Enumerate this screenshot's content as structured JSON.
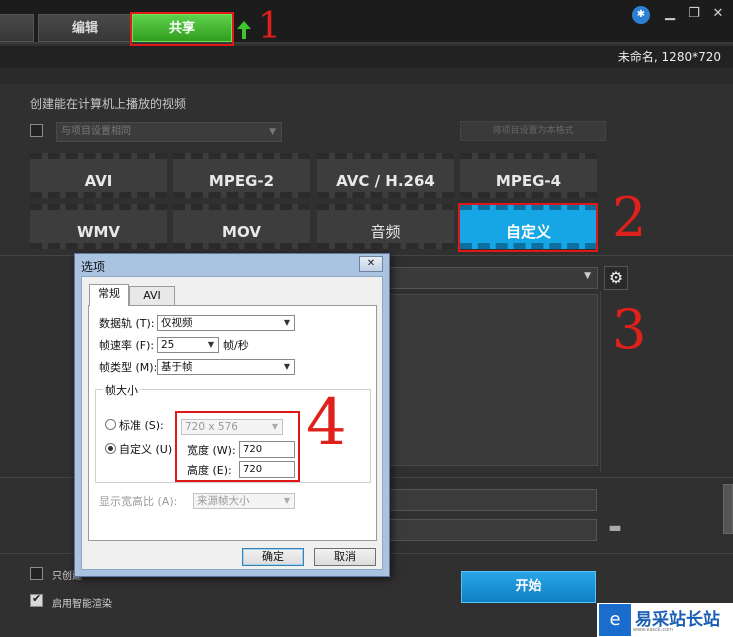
{
  "topbar": {
    "tabs": [
      {
        "label": ""
      },
      {
        "label": "编辑"
      },
      {
        "label": "共享"
      }
    ],
    "controls": {
      "help_icon": "compass-icon",
      "minimize": "▁",
      "restore": "❐",
      "close": "✕"
    }
  },
  "infobar": {
    "project": "未命名, 1280*720"
  },
  "share": {
    "title": "创建能在计算机上播放的视频",
    "same_as_project_checkbox": "与项目设置相同",
    "disabled_button": "将项目设置为本格式"
  },
  "formats": {
    "row1": [
      {
        "label": "AVI"
      },
      {
        "label": "MPEG-2"
      },
      {
        "label": "AVC / H.264"
      },
      {
        "label": "MPEG-4"
      }
    ],
    "row2": [
      {
        "label": "WMV"
      },
      {
        "label": "MOV"
      },
      {
        "label": "音频"
      },
      {
        "label": "自定义"
      }
    ]
  },
  "bottom": {
    "only_render_label": "只创建",
    "smart_render_label": "启用智能渲染",
    "start_button": "开始"
  },
  "dialog": {
    "title": "选项",
    "close": "✕",
    "tabs": [
      {
        "label": "常规"
      },
      {
        "label": "AVI"
      }
    ],
    "data_track_label": "数据轨 (T):",
    "data_track_value": "仅视频",
    "frame_rate_label": "帧速率 (F):",
    "frame_rate_value": "25",
    "frame_rate_unit": "帧/秒",
    "frame_type_label": "帧类型 (M):",
    "frame_type_value": "基于帧",
    "frame_size_group": "帧大小",
    "standard_label": "标准 (S):",
    "standard_value": "720 x 576",
    "custom_label": "自定义 (U)",
    "width_label": "宽度 (W):",
    "width_value": "720",
    "height_label": "高度 (E):",
    "height_value": "720",
    "aspect_label": "显示宽高比 (A):",
    "aspect_value": "来源帧大小",
    "ok_button": "确定",
    "cancel_button": "取消"
  },
  "annotations": {
    "n1": "1",
    "n2": "2",
    "n3": "3",
    "n4": "4"
  },
  "watermark": {
    "text": "易采站长站",
    "url": "www.easck.com"
  },
  "colors": {
    "accent_green": "#2f9e1f",
    "accent_blue": "#16a6e6",
    "annotation_red": "#e01818"
  }
}
